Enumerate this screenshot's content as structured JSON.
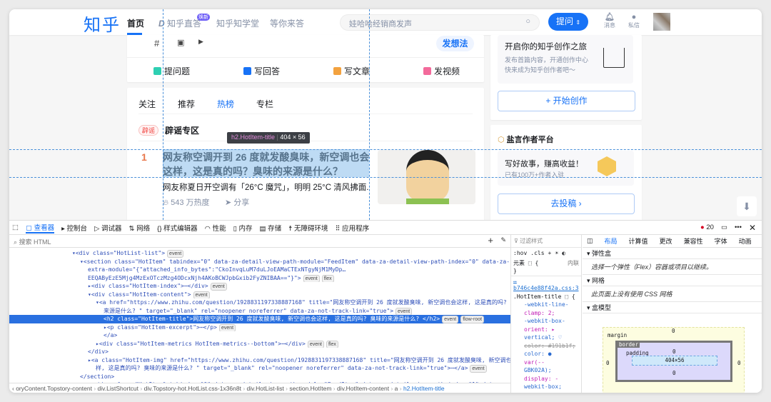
{
  "header": {
    "logo": "知乎",
    "nav": [
      "首页",
      "知乎直答",
      "知乎知学堂",
      "等你来答"
    ],
    "nav_badge": "焕新",
    "search_placeholder": "娃哈哈经销商发声",
    "ask_label": "提问",
    "ask_chevron": "⌃",
    "messages": "消息",
    "private_msg": "私信"
  },
  "composer": {
    "icons": [
      "#",
      "▣",
      "▶"
    ],
    "post_idea": "发想法",
    "actions": [
      "提问题",
      "写回答",
      "写文章",
      "发视频"
    ],
    "action_colors": [
      "#2ecfb2",
      "#1772f6",
      "#f3a23f",
      "#f36a9b"
    ]
  },
  "feed": {
    "tabs": [
      "关注",
      "推荐",
      "热榜",
      "专栏"
    ],
    "rumor_badge": "辟谣",
    "rumor_title": "辟谣专区",
    "item": {
      "rank": "1",
      "title": "网友称空调开到 26 度就发酸臭味，新空调也会这样，这是真的吗？臭味的来源是什么？",
      "excerpt": "网友称夏日开空调有「26°C 魔咒」，明明 25°C 清风拂面...",
      "heat": "543 万热度",
      "share": "分享"
    }
  },
  "tooltip": {
    "selector": "h2.HotItem-title",
    "size": "404 × 56"
  },
  "sidebar": {
    "creator_title": "开启你的知乎创作之旅",
    "creator_desc1": "发布首篇内容，开通创作中心",
    "creator_desc2": "快来成为知乎创作者吧～",
    "start_btn": "+ 开始创作",
    "yanyan_title": "盐言作者平台",
    "promo_title": "写好故事，赚高收益！",
    "promo_desc": "已有100万+作者入驻",
    "submit_btn": "去投稿 ›"
  },
  "devtools": {
    "tabs": [
      "查看器",
      "控制台",
      "调试器",
      "网络",
      "样式编辑器",
      "性能",
      "内存",
      "存储",
      "无障碍环境",
      "应用程序"
    ],
    "error_count": "20",
    "search_placeholder": "搜索 HTML",
    "tree": [
      {
        "indent": 8,
        "html": "▾<div class=\"HotList-list\">",
        "pills": [
          "event"
        ]
      },
      {
        "indent": 9,
        "html": "▾<section class=\"HotItem\" tabindex=\"0\" data-za-detail-view-path-module=\"FeedItem\" data-za-detail-view-path-index=\"0\" data-za-",
        "pills": []
      },
      {
        "indent": 10,
        "html": "extra-module=\"{\"attached_info_bytes\":\"CkoInvqLuM7duLJoEAMaCTExNTgyNjM1MyDp…",
        "pills": []
      },
      {
        "indent": 10,
        "html": "EEQAByEzE5Mjg4MzExOTczMzg4ODcxNjh4AKoBCWJpbGxib2FyZNIBAA==\"}\">",
        "pills": [
          "event",
          "flex"
        ]
      },
      {
        "indent": 10,
        "html": "▸<div class=\"HotItem-index\">⋯</div>",
        "pills": [
          "event"
        ]
      },
      {
        "indent": 10,
        "html": "▾<div class=\"HotItem-content\">",
        "pills": [
          "event"
        ]
      },
      {
        "indent": 11,
        "html": "▾<a href=\"https://www.zhihu.com/question/1928831197338887168\" title=\"网友称空调开到 26 度就发酸臭味, 新空调也会这样, 这是真的吗? 臭",
        "pills": []
      },
      {
        "indent": 12,
        "html": "来源是什么? \" target=\"_blank\" rel=\"noopener noreferrer\" data-za-not-track-link=\"true\">",
        "pills": [
          "event"
        ]
      },
      {
        "indent": 12,
        "html": "<h2 class=\"HotItem-title\">网友称空调开到 26 度就发酸臭味, 新空调也会这样, 这是真的吗? 臭味的来源是什么? </h2>",
        "pills": [
          "event",
          "flow-root"
        ],
        "selected": true
      },
      {
        "indent": 12,
        "html": "▸<p class=\"HotItem-excerpt\">⋯</p>",
        "pills": [
          "event"
        ]
      },
      {
        "indent": 12,
        "html": "</a>",
        "pills": []
      },
      {
        "indent": 11,
        "html": "▸<div class=\"HotItem-metrics HotItem-metrics--bottom\">⋯</div>",
        "pills": [
          "event",
          "flex"
        ]
      },
      {
        "indent": 10,
        "html": "</div>",
        "pills": []
      },
      {
        "indent": 10,
        "html": "▸<a class=\"HotItem-img\" href=\"https://www.zhihu.com/question/1928831197338887168\" title=\"网友称空调开到 26 度就发酸臭味, 新空调也",
        "pills": []
      },
      {
        "indent": 11,
        "html": "样, 这是真的吗? 臭味的来源是什么? \" target=\"_blank\" rel=\"noopener noreferrer\" data-za-not-track-link=\"true\">⋯</a>",
        "pills": [
          "event"
        ]
      },
      {
        "indent": 9,
        "html": "</section>",
        "pills": []
      },
      {
        "indent": 9,
        "html": "▸<section class=\"HotItem\" tabindex=\"0\" data-za-detail-view-path-module=\"FeedItem\" data-za-detail-view-path-index=\"1\" data-za-",
        "pills": []
      }
    ],
    "breadcrumb": [
      "oryContent.Topstory-content",
      "div.ListShortcut",
      "div.Topstory-hot.HotList.css-1x36n8t",
      "div.HotList-list",
      "section.HotItem",
      "div.HotItem-content",
      "a",
      "h2.HotItem-title"
    ],
    "rules": {
      "filter": "过滤样式",
      "hov": ":hov",
      "cls": ".cls",
      "element": "元素 ⬚ {",
      "inline": "内联",
      "close": "}",
      "source": "…b746c4e88f42a.css:3",
      "selector": ".HotItem-title ⬚ {",
      "lines": [
        "-webkit-line-",
        "clamp: 2;",
        "-webkit-box-",
        "orient: ▸",
        "vertical; ♡",
        "color: #191b1f;",
        "color: ●",
        "var(--",
        "GBK02A);",
        "display: -",
        "webkit-box;",
        "font-size:"
      ]
    },
    "layout_tabs": [
      "布局",
      "计算值",
      "更改",
      "兼容性",
      "字体",
      "动画"
    ],
    "flex_section": "弹性盒",
    "flex_hint": "选择一个弹性（Flex）容器或项目以继续。",
    "grid_section": "网格",
    "grid_hint": "此页面上没有使用 CSS 网格",
    "box_section": "盒模型",
    "box": {
      "margin": "margin",
      "border": "border",
      "padding": "padding",
      "content": "404×56",
      "zero": "0"
    }
  }
}
